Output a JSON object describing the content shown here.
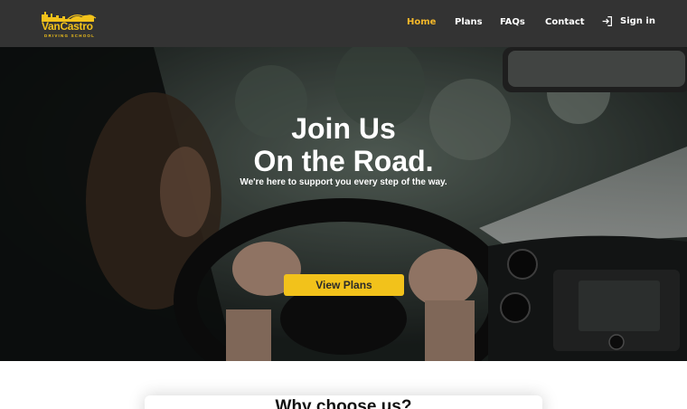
{
  "brand": {
    "name": "VanCastro",
    "tagline": "DRIVING SCHOOL",
    "color": "#f2c21b"
  },
  "nav": {
    "items": [
      {
        "label": "Home",
        "active": true
      },
      {
        "label": "Plans",
        "active": false
      },
      {
        "label": "FAQs",
        "active": false
      },
      {
        "label": "Contact",
        "active": false
      }
    ],
    "signin": {
      "label": "Sign in",
      "icon": "login-icon"
    },
    "active_color": "#f5b82a",
    "bg_color": "#333333"
  },
  "hero": {
    "title_line1": "Join Us",
    "title_line2": "On the Road.",
    "subtitle": "We're here to support you every step of the way.",
    "cta_label": "View Plans",
    "cta_color": "#f2c21b"
  },
  "section": {
    "title": "Why choose us?"
  }
}
